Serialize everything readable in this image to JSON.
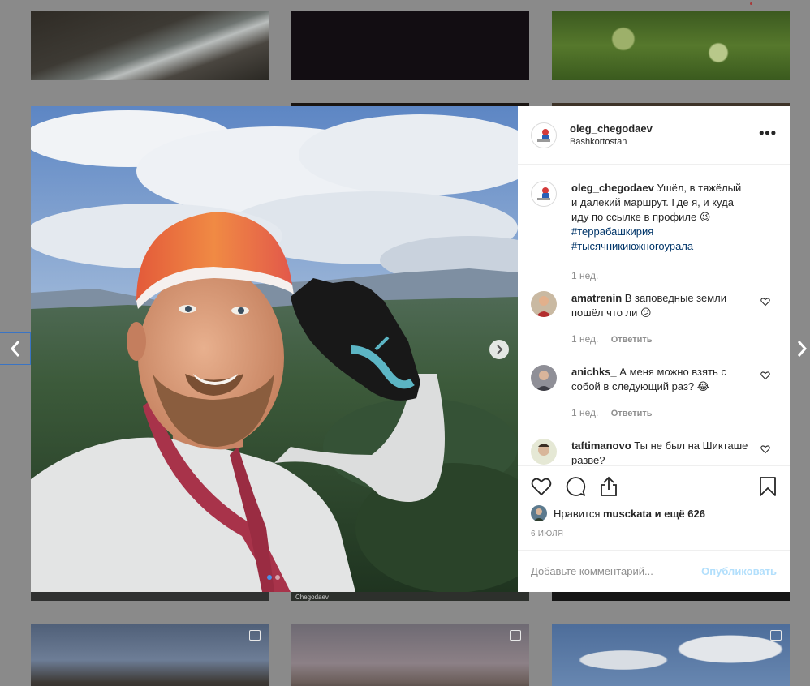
{
  "post": {
    "username": "oleg_chegodaev",
    "location": "Bashkortostan",
    "more_label": "•••",
    "caption_text": "Ушёл, в тяжёлый и далекий маршрут. Где я, и куда иду по ссылке в профиле 😉",
    "hashtags": [
      "#террабашкирия",
      "#тысячникиюжногоурала"
    ],
    "caption_time": "1 нед.",
    "likes_prefix": "Нравится",
    "likes_user": "musckata",
    "likes_suffix": "и ещё 626",
    "date": "6 ИЮЛЯ"
  },
  "comments": [
    {
      "user": "amatrenin",
      "text": "В заповедные земли пошёл что ли 😕",
      "time": "1 нед.",
      "reply": "Ответить"
    },
    {
      "user": "anichks_",
      "text": "А меня можно взять с собой в следующий раз? 😂",
      "time": "1 нед.",
      "reply": "Ответить"
    },
    {
      "user": "taftimanovo",
      "text": "Ты не был на Шикташе разве?"
    }
  ],
  "comment_box": {
    "placeholder": "Добавьте комментарий...",
    "publish": "Опубликовать"
  },
  "background": {
    "tile_caption": "Chegodaev"
  },
  "carousel": {
    "count": 2,
    "active": 0
  },
  "colors": {
    "hashtag": "#003569",
    "publish": "#b2dffc",
    "muted": "#8e8e8e"
  }
}
